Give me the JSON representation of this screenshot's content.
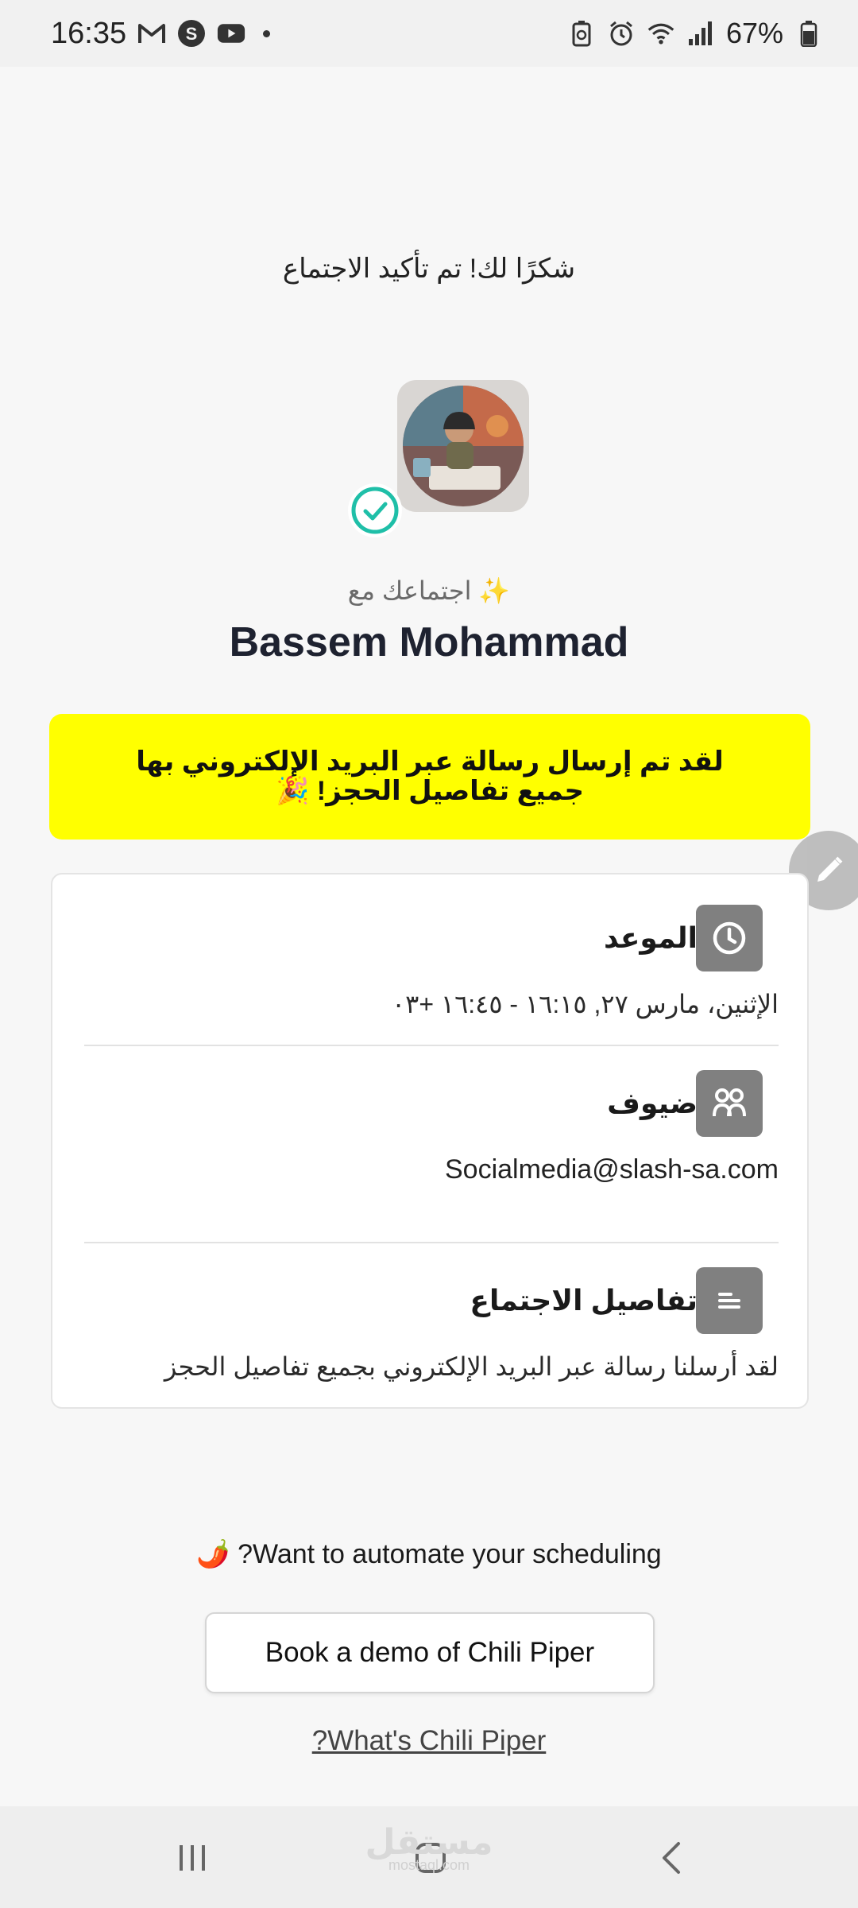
{
  "status_bar": {
    "time": "16:35",
    "battery": "67%",
    "icons": [
      "gmail-icon",
      "s-app-icon",
      "youtube-icon",
      "dot-icon",
      "battery-saver-icon",
      "alarm-icon",
      "wifi-icon",
      "signal-icon",
      "battery-icon"
    ]
  },
  "page": {
    "thanks": "شكرًا لك! تم تأكيد الاجتماع",
    "meeting_with": "✨ اجتماعك مع",
    "host_name": "Bassem Mohammad",
    "banner": "لقد تم إرسال رسالة عبر البريد الإلكتروني بها جميع تفاصيل الحجز! 🎉"
  },
  "card": {
    "time_section": {
      "title": "الموعد",
      "value": "الإثنين، مارس ٢٧, ١٦:١٥ - ١٦:٤٥ +٠٣"
    },
    "guests_section": {
      "title": "ضيوف",
      "value": "Socialmedia@slash-sa.com"
    },
    "details_section": {
      "title": "تفاصيل الاجتماع",
      "value": "لقد أرسلنا رسالة عبر البريد الإلكتروني بجميع تفاصيل الحجز"
    }
  },
  "footer": {
    "automate": "?Want to automate your scheduling",
    "automate_emoji": "🌶️",
    "demo_button": "Book a demo of Chili Piper",
    "whats_link": "?What's Chili Piper"
  },
  "watermark": {
    "text": "مستقل",
    "sub": "mostaql.com"
  },
  "colors": {
    "banner": "#ffff00",
    "check": "#1fbfa8",
    "section_icon_bg": "#808080"
  }
}
